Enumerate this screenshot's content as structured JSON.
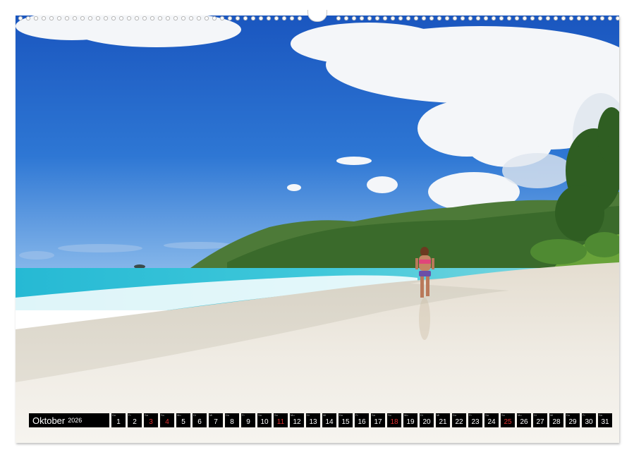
{
  "calendar": {
    "month": "Oktober",
    "year": "2026",
    "days": [
      {
        "wd": "Do",
        "n": "1",
        "holiday": false
      },
      {
        "wd": "Fr",
        "n": "2",
        "holiday": false
      },
      {
        "wd": "Sa",
        "n": "3",
        "holiday": true
      },
      {
        "wd": "So",
        "n": "4",
        "holiday": true
      },
      {
        "wd": "Mo",
        "n": "5",
        "holiday": false
      },
      {
        "wd": "Di",
        "n": "6",
        "holiday": false
      },
      {
        "wd": "Mi",
        "n": "7",
        "holiday": false
      },
      {
        "wd": "Do",
        "n": "8",
        "holiday": false
      },
      {
        "wd": "Fr",
        "n": "9",
        "holiday": false
      },
      {
        "wd": "Sa",
        "n": "10",
        "holiday": false
      },
      {
        "wd": "So",
        "n": "11",
        "holiday": true
      },
      {
        "wd": "Mo",
        "n": "12",
        "holiday": false
      },
      {
        "wd": "Di",
        "n": "13",
        "holiday": false
      },
      {
        "wd": "Mi",
        "n": "14",
        "holiday": false
      },
      {
        "wd": "Do",
        "n": "15",
        "holiday": false
      },
      {
        "wd": "Fr",
        "n": "16",
        "holiday": false
      },
      {
        "wd": "Sa",
        "n": "17",
        "holiday": false
      },
      {
        "wd": "So",
        "n": "18",
        "holiday": true
      },
      {
        "wd": "Mo",
        "n": "19",
        "holiday": false
      },
      {
        "wd": "Di",
        "n": "20",
        "holiday": false
      },
      {
        "wd": "Mi",
        "n": "21",
        "holiday": false
      },
      {
        "wd": "Do",
        "n": "22",
        "holiday": false
      },
      {
        "wd": "Fr",
        "n": "23",
        "holiday": false
      },
      {
        "wd": "Sa",
        "n": "24",
        "holiday": false
      },
      {
        "wd": "So",
        "n": "25",
        "holiday": true
      },
      {
        "wd": "Mo",
        "n": "26",
        "holiday": false
      },
      {
        "wd": "Di",
        "n": "27",
        "holiday": false
      },
      {
        "wd": "Mi",
        "n": "28",
        "holiday": false
      },
      {
        "wd": "Do",
        "n": "29",
        "holiday": false
      },
      {
        "wd": "Fr",
        "n": "30",
        "holiday": false
      },
      {
        "wd": "Sa",
        "n": "31",
        "holiday": false
      }
    ]
  },
  "colors": {
    "sky_top": "#1f5fc4",
    "sky_horizon": "#7fb0e6",
    "sea": "#2fc0d6",
    "sand": "#ece7dc",
    "vegetation": "#3f7a2c",
    "calendar_bg": "#000000",
    "holiday_red": "#e23030"
  },
  "image": {
    "subject": "tropical-beach-photo"
  }
}
